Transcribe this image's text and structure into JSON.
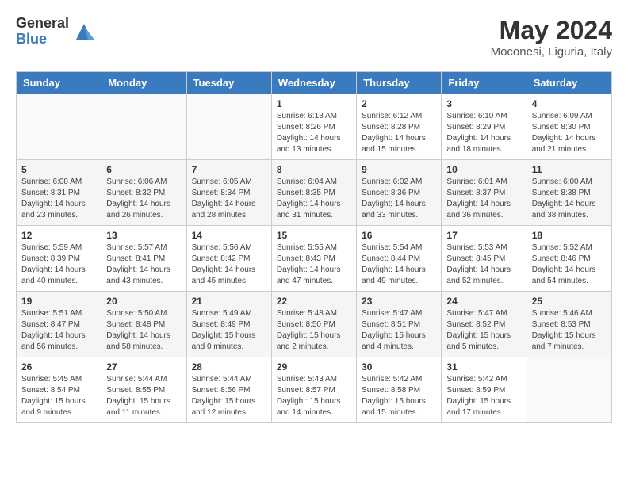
{
  "logo": {
    "general": "General",
    "blue": "Blue"
  },
  "title": "May 2024",
  "subtitle": "Moconesi, Liguria, Italy",
  "days_of_week": [
    "Sunday",
    "Monday",
    "Tuesday",
    "Wednesday",
    "Thursday",
    "Friday",
    "Saturday"
  ],
  "weeks": [
    [
      {
        "day": "",
        "info": ""
      },
      {
        "day": "",
        "info": ""
      },
      {
        "day": "",
        "info": ""
      },
      {
        "day": "1",
        "info": "Sunrise: 6:13 AM\nSunset: 8:26 PM\nDaylight: 14 hours and 13 minutes."
      },
      {
        "day": "2",
        "info": "Sunrise: 6:12 AM\nSunset: 8:28 PM\nDaylight: 14 hours and 15 minutes."
      },
      {
        "day": "3",
        "info": "Sunrise: 6:10 AM\nSunset: 8:29 PM\nDaylight: 14 hours and 18 minutes."
      },
      {
        "day": "4",
        "info": "Sunrise: 6:09 AM\nSunset: 8:30 PM\nDaylight: 14 hours and 21 minutes."
      }
    ],
    [
      {
        "day": "5",
        "info": "Sunrise: 6:08 AM\nSunset: 8:31 PM\nDaylight: 14 hours and 23 minutes."
      },
      {
        "day": "6",
        "info": "Sunrise: 6:06 AM\nSunset: 8:32 PM\nDaylight: 14 hours and 26 minutes."
      },
      {
        "day": "7",
        "info": "Sunrise: 6:05 AM\nSunset: 8:34 PM\nDaylight: 14 hours and 28 minutes."
      },
      {
        "day": "8",
        "info": "Sunrise: 6:04 AM\nSunset: 8:35 PM\nDaylight: 14 hours and 31 minutes."
      },
      {
        "day": "9",
        "info": "Sunrise: 6:02 AM\nSunset: 8:36 PM\nDaylight: 14 hours and 33 minutes."
      },
      {
        "day": "10",
        "info": "Sunrise: 6:01 AM\nSunset: 8:37 PM\nDaylight: 14 hours and 36 minutes."
      },
      {
        "day": "11",
        "info": "Sunrise: 6:00 AM\nSunset: 8:38 PM\nDaylight: 14 hours and 38 minutes."
      }
    ],
    [
      {
        "day": "12",
        "info": "Sunrise: 5:59 AM\nSunset: 8:39 PM\nDaylight: 14 hours and 40 minutes."
      },
      {
        "day": "13",
        "info": "Sunrise: 5:57 AM\nSunset: 8:41 PM\nDaylight: 14 hours and 43 minutes."
      },
      {
        "day": "14",
        "info": "Sunrise: 5:56 AM\nSunset: 8:42 PM\nDaylight: 14 hours and 45 minutes."
      },
      {
        "day": "15",
        "info": "Sunrise: 5:55 AM\nSunset: 8:43 PM\nDaylight: 14 hours and 47 minutes."
      },
      {
        "day": "16",
        "info": "Sunrise: 5:54 AM\nSunset: 8:44 PM\nDaylight: 14 hours and 49 minutes."
      },
      {
        "day": "17",
        "info": "Sunrise: 5:53 AM\nSunset: 8:45 PM\nDaylight: 14 hours and 52 minutes."
      },
      {
        "day": "18",
        "info": "Sunrise: 5:52 AM\nSunset: 8:46 PM\nDaylight: 14 hours and 54 minutes."
      }
    ],
    [
      {
        "day": "19",
        "info": "Sunrise: 5:51 AM\nSunset: 8:47 PM\nDaylight: 14 hours and 56 minutes."
      },
      {
        "day": "20",
        "info": "Sunrise: 5:50 AM\nSunset: 8:48 PM\nDaylight: 14 hours and 58 minutes."
      },
      {
        "day": "21",
        "info": "Sunrise: 5:49 AM\nSunset: 8:49 PM\nDaylight: 15 hours and 0 minutes."
      },
      {
        "day": "22",
        "info": "Sunrise: 5:48 AM\nSunset: 8:50 PM\nDaylight: 15 hours and 2 minutes."
      },
      {
        "day": "23",
        "info": "Sunrise: 5:47 AM\nSunset: 8:51 PM\nDaylight: 15 hours and 4 minutes."
      },
      {
        "day": "24",
        "info": "Sunrise: 5:47 AM\nSunset: 8:52 PM\nDaylight: 15 hours and 5 minutes."
      },
      {
        "day": "25",
        "info": "Sunrise: 5:46 AM\nSunset: 8:53 PM\nDaylight: 15 hours and 7 minutes."
      }
    ],
    [
      {
        "day": "26",
        "info": "Sunrise: 5:45 AM\nSunset: 8:54 PM\nDaylight: 15 hours and 9 minutes."
      },
      {
        "day": "27",
        "info": "Sunrise: 5:44 AM\nSunset: 8:55 PM\nDaylight: 15 hours and 11 minutes."
      },
      {
        "day": "28",
        "info": "Sunrise: 5:44 AM\nSunset: 8:56 PM\nDaylight: 15 hours and 12 minutes."
      },
      {
        "day": "29",
        "info": "Sunrise: 5:43 AM\nSunset: 8:57 PM\nDaylight: 15 hours and 14 minutes."
      },
      {
        "day": "30",
        "info": "Sunrise: 5:42 AM\nSunset: 8:58 PM\nDaylight: 15 hours and 15 minutes."
      },
      {
        "day": "31",
        "info": "Sunrise: 5:42 AM\nSunset: 8:59 PM\nDaylight: 15 hours and 17 minutes."
      },
      {
        "day": "",
        "info": ""
      }
    ]
  ]
}
